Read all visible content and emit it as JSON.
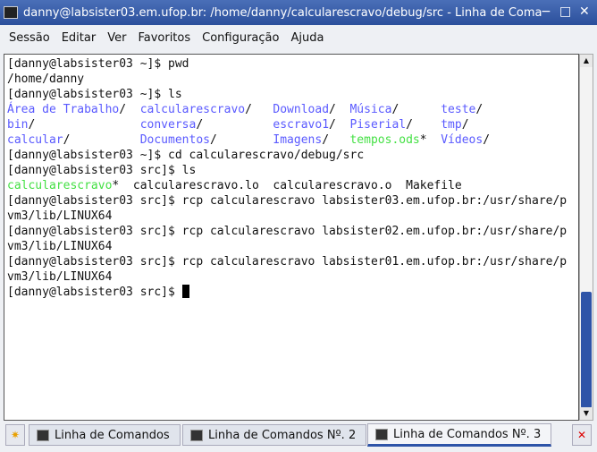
{
  "window": {
    "title": "danny@labsister03.em.ufop.br: /home/danny/calcularescravo/debug/src - Linha de Coma",
    "minimize": "−",
    "maximize": "□",
    "close": "✕"
  },
  "menu": [
    "Sessão",
    "Editar",
    "Ver",
    "Favoritos",
    "Configuração",
    "Ajuda"
  ],
  "terminal": {
    "l1": "[danny@labsister03 ~]$ pwd",
    "l2": "/home/danny",
    "l3": "[danny@labsister03 ~]$ ls",
    "ls_rows": [
      [
        {
          "n": "Área de Trabalho",
          "s": "/"
        },
        {
          "n": "calcularescravo",
          "s": "/"
        },
        {
          "n": "Download",
          "s": "/"
        },
        {
          "n": "Música",
          "s": "/"
        },
        {
          "n": "teste",
          "s": "/"
        }
      ],
      [
        {
          "n": "bin",
          "s": "/"
        },
        {
          "n": "conversa",
          "s": "/"
        },
        {
          "n": "escravo1",
          "s": "/"
        },
        {
          "n": "Piserial",
          "s": "/"
        },
        {
          "n": "tmp",
          "s": "/"
        }
      ],
      [
        {
          "n": "calcular",
          "s": "/"
        },
        {
          "n": "Documentos",
          "s": "/"
        },
        {
          "n": "Imagens",
          "s": "/"
        },
        {
          "n": "tempos.ods",
          "s": "*"
        },
        {
          "n": "Vídeos",
          "s": "/"
        }
      ]
    ],
    "l7": "[danny@labsister03 ~]$ cd calcularescravo/debug/src",
    "l8": "[danny@labsister03 src]$ ls",
    "l9": {
      "exe": "calcularescravo",
      "star": "*",
      "rest": "  calcularescravo.lo  calcularescravo.o  Makefile"
    },
    "l10": "[danny@labsister03 src]$ rcp calcularescravo labsister03.em.ufop.br:/usr/share/p",
    "l11": "vm3/lib/LINUX64",
    "l12": "[danny@labsister03 src]$ rcp calcularescravo labsister02.em.ufop.br:/usr/share/p",
    "l13": "vm3/lib/LINUX64",
    "l14": "[danny@labsister03 src]$ rcp calcularescravo labsister01.em.ufop.br:/usr/share/p",
    "l15": "vm3/lib/LINUX64",
    "l16": "[danny@labsister03 src]$ "
  },
  "tabs": [
    "Linha de Comandos",
    "Linha de Comandos Nº. 2",
    "Linha de Comandos Nº. 3"
  ],
  "colors": {
    "directory": "#5a5aff",
    "executable": "#44e044",
    "accent": "#2e54a8"
  }
}
